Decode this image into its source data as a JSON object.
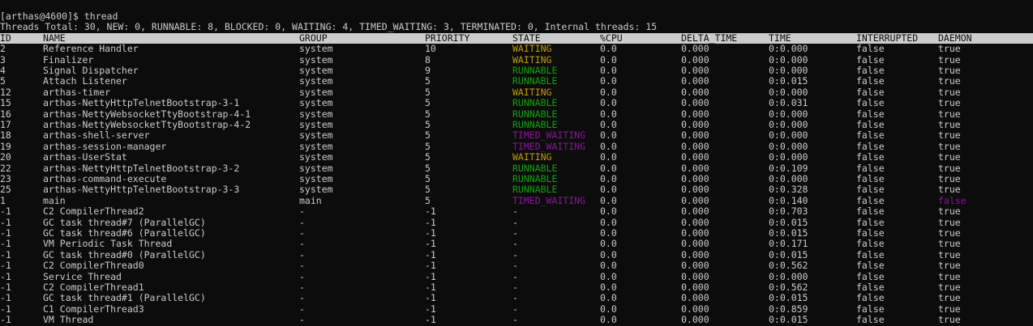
{
  "prompt": "[arthas@4600]$ thread",
  "summary": "Threads Total: 30, NEW: 0, RUNNABLE: 8, BLOCKED: 0, WAITING: 4, TIMED_WAITING: 3, TERMINATED: 0, Internal threads: 15",
  "colors": {
    "background": "#0c0c0c",
    "text": "#cccccc",
    "waiting": "#c19c00",
    "runnable": "#13a10e",
    "timed_waiting": "#881798",
    "daemon_false": "#881798"
  },
  "headers": [
    "ID",
    "NAME",
    "GROUP",
    "PRIORITY",
    "STATE",
    "%CPU",
    "DELTA_TIME",
    "TIME",
    "INTERRUPTED",
    "DAEMON"
  ],
  "rows": [
    {
      "id": "2",
      "name": "Reference Handler",
      "group": "system",
      "priority": "10",
      "state": "WAITING",
      "cpu": "0.0",
      "delta": "0.000",
      "time": "0:0.000",
      "interrupted": "false",
      "daemon": "true"
    },
    {
      "id": "3",
      "name": "Finalizer",
      "group": "system",
      "priority": "8",
      "state": "WAITING",
      "cpu": "0.0",
      "delta": "0.000",
      "time": "0:0.000",
      "interrupted": "false",
      "daemon": "true"
    },
    {
      "id": "4",
      "name": "Signal Dispatcher",
      "group": "system",
      "priority": "9",
      "state": "RUNNABLE",
      "cpu": "0.0",
      "delta": "0.000",
      "time": "0:0.000",
      "interrupted": "false",
      "daemon": "true"
    },
    {
      "id": "5",
      "name": "Attach Listener",
      "group": "system",
      "priority": "5",
      "state": "RUNNABLE",
      "cpu": "0.0",
      "delta": "0.000",
      "time": "0:0.015",
      "interrupted": "false",
      "daemon": "true"
    },
    {
      "id": "12",
      "name": "arthas-timer",
      "group": "system",
      "priority": "5",
      "state": "WAITING",
      "cpu": "0.0",
      "delta": "0.000",
      "time": "0:0.000",
      "interrupted": "false",
      "daemon": "true"
    },
    {
      "id": "15",
      "name": "arthas-NettyHttpTelnetBootstrap-3-1",
      "group": "system",
      "priority": "5",
      "state": "RUNNABLE",
      "cpu": "0.0",
      "delta": "0.000",
      "time": "0:0.031",
      "interrupted": "false",
      "daemon": "true"
    },
    {
      "id": "16",
      "name": "arthas-NettyWebsocketTtyBootstrap-4-1",
      "group": "system",
      "priority": "5",
      "state": "RUNNABLE",
      "cpu": "0.0",
      "delta": "0.000",
      "time": "0:0.000",
      "interrupted": "false",
      "daemon": "true"
    },
    {
      "id": "17",
      "name": "arthas-NettyWebsocketTtyBootstrap-4-2",
      "group": "system",
      "priority": "5",
      "state": "RUNNABLE",
      "cpu": "0.0",
      "delta": "0.000",
      "time": "0:0.000",
      "interrupted": "false",
      "daemon": "true"
    },
    {
      "id": "18",
      "name": "arthas-shell-server",
      "group": "system",
      "priority": "5",
      "state": "TIMED_WAITING",
      "cpu": "0.0",
      "delta": "0.000",
      "time": "0:0.000",
      "interrupted": "false",
      "daemon": "true"
    },
    {
      "id": "19",
      "name": "arthas-session-manager",
      "group": "system",
      "priority": "5",
      "state": "TIMED_WAITING",
      "cpu": "0.0",
      "delta": "0.000",
      "time": "0:0.000",
      "interrupted": "false",
      "daemon": "true"
    },
    {
      "id": "20",
      "name": "arthas-UserStat",
      "group": "system",
      "priority": "5",
      "state": "WAITING",
      "cpu": "0.0",
      "delta": "0.000",
      "time": "0:0.000",
      "interrupted": "false",
      "daemon": "true"
    },
    {
      "id": "22",
      "name": "arthas-NettyHttpTelnetBootstrap-3-2",
      "group": "system",
      "priority": "5",
      "state": "RUNNABLE",
      "cpu": "0.0",
      "delta": "0.000",
      "time": "0:0.109",
      "interrupted": "false",
      "daemon": "true"
    },
    {
      "id": "23",
      "name": "arthas-command-execute",
      "group": "system",
      "priority": "5",
      "state": "RUNNABLE",
      "cpu": "0.0",
      "delta": "0.000",
      "time": "0:0.000",
      "interrupted": "false",
      "daemon": "true"
    },
    {
      "id": "25",
      "name": "arthas-NettyHttpTelnetBootstrap-3-3",
      "group": "system",
      "priority": "5",
      "state": "RUNNABLE",
      "cpu": "0.0",
      "delta": "0.000",
      "time": "0:0.328",
      "interrupted": "false",
      "daemon": "true"
    },
    {
      "id": "1",
      "name": "main",
      "group": "main",
      "priority": "5",
      "state": "TIMED_WAITING",
      "cpu": "0.0",
      "delta": "0.000",
      "time": "0:0.140",
      "interrupted": "false",
      "daemon": "false"
    },
    {
      "id": "-1",
      "name": "C2 CompilerThread2",
      "group": "-",
      "priority": "-1",
      "state": "-",
      "cpu": "0.0",
      "delta": "0.000",
      "time": "0:0.703",
      "interrupted": "false",
      "daemon": "true"
    },
    {
      "id": "-1",
      "name": "GC task thread#7 (ParallelGC)",
      "group": "-",
      "priority": "-1",
      "state": "-",
      "cpu": "0.0",
      "delta": "0.000",
      "time": "0:0.015",
      "interrupted": "false",
      "daemon": "true"
    },
    {
      "id": "-1",
      "name": "GC task thread#6 (ParallelGC)",
      "group": "-",
      "priority": "-1",
      "state": "-",
      "cpu": "0.0",
      "delta": "0.000",
      "time": "0:0.015",
      "interrupted": "false",
      "daemon": "true"
    },
    {
      "id": "-1",
      "name": "VM Periodic Task Thread",
      "group": "-",
      "priority": "-1",
      "state": "-",
      "cpu": "0.0",
      "delta": "0.000",
      "time": "0:0.171",
      "interrupted": "false",
      "daemon": "true"
    },
    {
      "id": "-1",
      "name": "GC task thread#0 (ParallelGC)",
      "group": "-",
      "priority": "-1",
      "state": "-",
      "cpu": "0.0",
      "delta": "0.000",
      "time": "0:0.015",
      "interrupted": "false",
      "daemon": "true"
    },
    {
      "id": "-1",
      "name": "C2 CompilerThread0",
      "group": "-",
      "priority": "-1",
      "state": "-",
      "cpu": "0.0",
      "delta": "0.000",
      "time": "0:0.562",
      "interrupted": "false",
      "daemon": "true"
    },
    {
      "id": "-1",
      "name": "Service Thread",
      "group": "-",
      "priority": "-1",
      "state": "-",
      "cpu": "0.0",
      "delta": "0.000",
      "time": "0:0.000",
      "interrupted": "false",
      "daemon": "true"
    },
    {
      "id": "-1",
      "name": "C2 CompilerThread1",
      "group": "-",
      "priority": "-1",
      "state": "-",
      "cpu": "0.0",
      "delta": "0.000",
      "time": "0:0.562",
      "interrupted": "false",
      "daemon": "true"
    },
    {
      "id": "-1",
      "name": "GC task thread#1 (ParallelGC)",
      "group": "-",
      "priority": "-1",
      "state": "-",
      "cpu": "0.0",
      "delta": "0.000",
      "time": "0:0.015",
      "interrupted": "false",
      "daemon": "true"
    },
    {
      "id": "-1",
      "name": "C1 CompilerThread3",
      "group": "-",
      "priority": "-1",
      "state": "-",
      "cpu": "0.0",
      "delta": "0.000",
      "time": "0:0.859",
      "interrupted": "false",
      "daemon": "true"
    },
    {
      "id": "-1",
      "name": "VM Thread",
      "group": "-",
      "priority": "-1",
      "state": "-",
      "cpu": "0.0",
      "delta": "0.000",
      "time": "0:0.015",
      "interrupted": "false",
      "daemon": "true"
    }
  ]
}
